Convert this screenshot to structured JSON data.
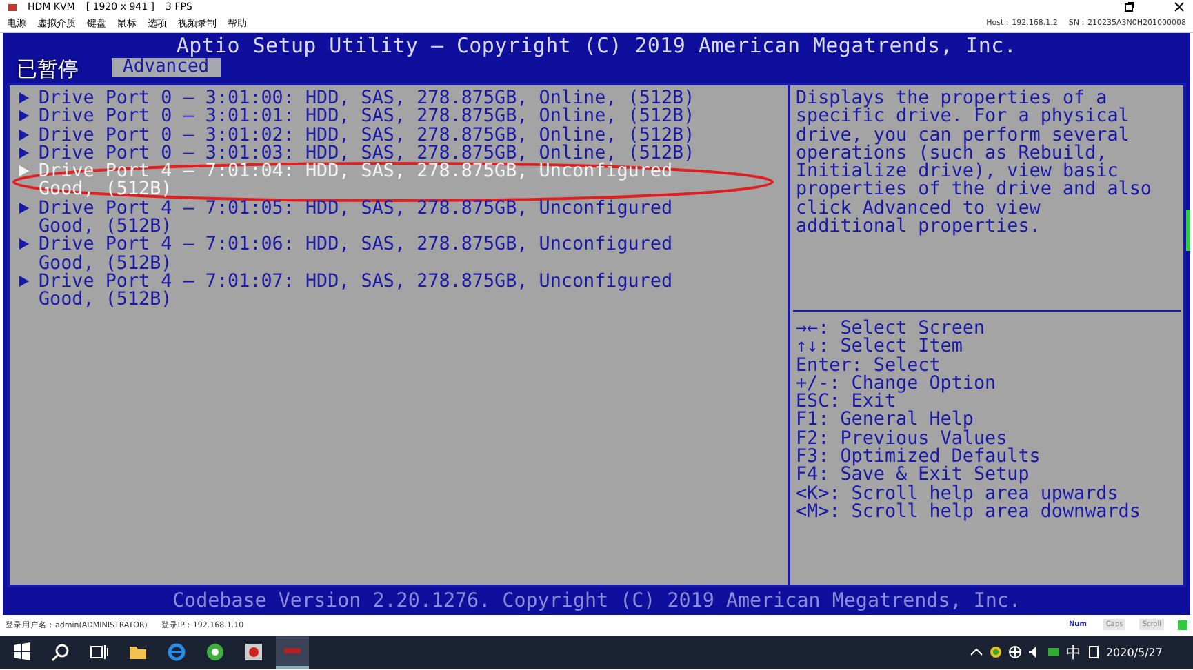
{
  "window": {
    "title": "HDM KVM",
    "resolution": "[ 1920 x 941 ]",
    "fps": "3 FPS"
  },
  "menu": [
    "电源",
    "虚拟介质",
    "键盘",
    "鼠标",
    "选项",
    "视频录制",
    "帮助"
  ],
  "host_info": [
    "Host：192.168.1.2",
    "SN：210235A3N0H201000008"
  ],
  "bios": {
    "title": "Aptio Setup Utility – Copyright (C) 2019 American Megatrends, Inc.",
    "tabs": [
      {
        "label": "Advanced",
        "selected": true
      }
    ],
    "overlay": "已暂停",
    "drives": [
      {
        "label": "Drive Port 0 – 3:01:00: HDD, SAS, 278.875GB, Online, (512B)",
        "selected": false
      },
      {
        "label": "Drive Port 0 – 3:01:01: HDD, SAS, 278.875GB, Online, (512B)",
        "selected": false
      },
      {
        "label": "Drive Port 0 – 3:01:02: HDD, SAS, 278.875GB, Online, (512B)",
        "selected": false
      },
      {
        "label": "Drive Port 0 – 3:01:03: HDD, SAS, 278.875GB, Online, (512B)",
        "selected": false
      },
      {
        "label": "Drive Port 4 – 7:01:04: HDD, SAS, 278.875GB, Unconfigured Good, (512B)",
        "selected": true
      },
      {
        "label": "Drive Port 4 – 7:01:05: HDD, SAS, 278.875GB, Unconfigured Good, (512B)",
        "selected": false
      },
      {
        "label": "Drive Port 4 – 7:01:06: HDD, SAS, 278.875GB, Unconfigured Good, (512B)",
        "selected": false
      },
      {
        "label": "Drive Port 4 – 7:01:07: HDD, SAS, 278.875GB, Unconfigured Good, (512B)",
        "selected": false
      }
    ],
    "help": "Displays the properties of a specific drive. For a physical drive, you can perform several operations (such as Rebuild, Initialize drive), view basic properties of the drive and also click Advanced to view additional properties.",
    "keys": [
      "→←: Select Screen",
      "↑↓: Select Item",
      "Enter: Select",
      "+/-: Change Option",
      "ESC: Exit",
      "F1: General Help",
      "F2: Previous Values",
      "F3: Optimized Defaults",
      "F4: Save & Exit Setup",
      "<K>: Scroll help area upwards",
      "<M>: Scroll help area downwards"
    ],
    "footer": "Codebase Version 2.20.1276. Copyright (C) 2019 American Megatrends, Inc."
  },
  "status_bar": {
    "user": "登录用户名：admin(ADMINISTRATOR)",
    "ip": "登录IP：192.168.1.10",
    "indicators": [
      {
        "label": "Num",
        "on": true
      },
      {
        "label": "Caps",
        "on": false
      },
      {
        "label": "Scroll",
        "on": false
      }
    ]
  },
  "taskbar": {
    "ime": "中",
    "date": "2020/5/27"
  }
}
